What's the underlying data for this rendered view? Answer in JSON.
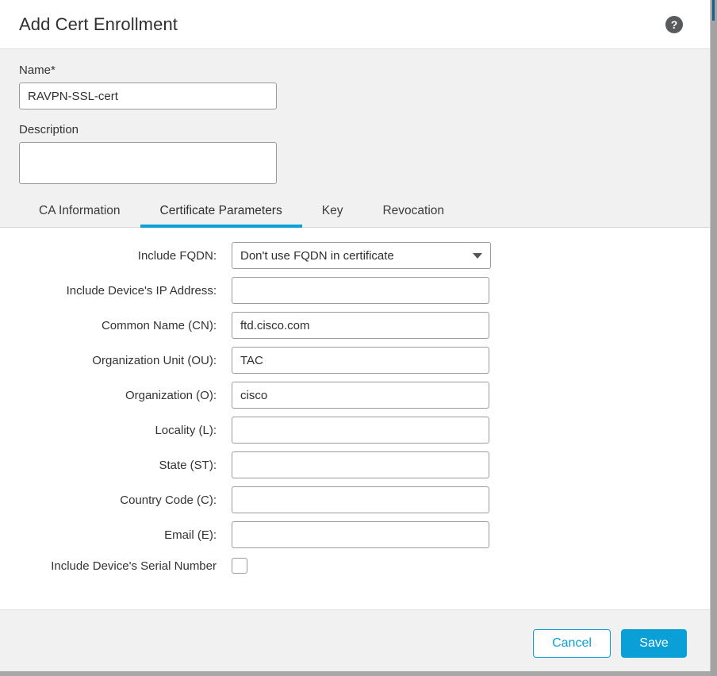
{
  "header": {
    "title": "Add Cert Enrollment",
    "help_icon": "help-question-icon",
    "help_glyph": "?"
  },
  "top_section": {
    "name_label": "Name*",
    "name_value": "RAVPN-SSL-cert",
    "name_placeholder": "",
    "description_label": "Description",
    "description_value": "",
    "description_placeholder": ""
  },
  "tabs": [
    {
      "label": "CA Information",
      "active": false
    },
    {
      "label": "Certificate Parameters",
      "active": true
    },
    {
      "label": "Key",
      "active": false
    },
    {
      "label": "Revocation",
      "active": false
    }
  ],
  "form": {
    "include_fqdn": {
      "label": "Include FQDN:",
      "value": "Don't use FQDN in certificate",
      "caret_icon": "chevron-down-icon"
    },
    "device_ip": {
      "label": "Include Device's IP Address:",
      "value": "",
      "placeholder": ""
    },
    "common_name": {
      "label": "Common Name (CN):",
      "value": "ftd.cisco.com",
      "placeholder": ""
    },
    "org_unit": {
      "label": "Organization Unit (OU):",
      "value": "TAC",
      "placeholder": ""
    },
    "organization": {
      "label": "Organization (O):",
      "value": "cisco",
      "placeholder": ""
    },
    "locality": {
      "label": "Locality (L):",
      "value": "",
      "placeholder": ""
    },
    "state": {
      "label": "State (ST):",
      "value": "",
      "placeholder": ""
    },
    "country_code": {
      "label": "Country Code (C):",
      "value": "",
      "placeholder": ""
    },
    "email": {
      "label": "Email (E):",
      "value": "",
      "placeholder": ""
    },
    "serial_number": {
      "label": "Include Device's Serial Number",
      "checked": false
    }
  },
  "footer": {
    "cancel_label": "Cancel",
    "save_label": "Save"
  },
  "colors": {
    "accent_blue": "#0b9fd8",
    "section_gray": "#f1f1f1",
    "border_gray": "#9b9b9b",
    "text_dark": "#333333",
    "help_circle": "#585a5c"
  }
}
